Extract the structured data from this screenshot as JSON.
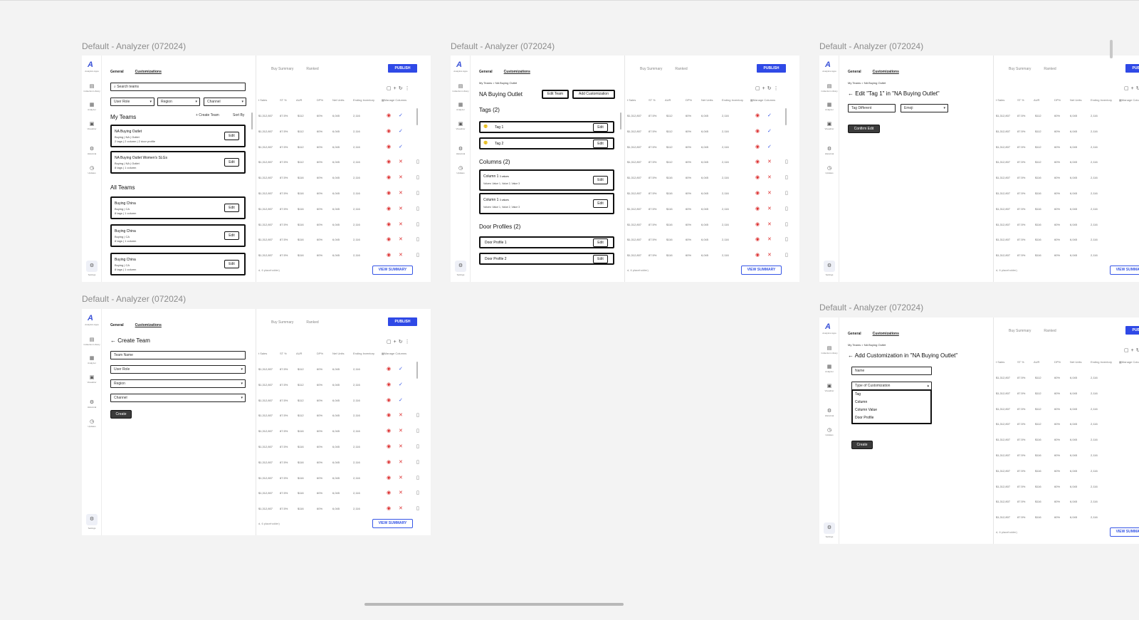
{
  "canvas": {
    "frame_label": "Default - Analyzer (072024)"
  },
  "app": {
    "sidebar": [
      {
        "glyph": "▤",
        "label": "Collection Library"
      },
      {
        "glyph": "▦",
        "label": "Analyzer"
      },
      {
        "glyph": "▣",
        "label": "Visualizer"
      },
      {
        "glyph": "⚙",
        "label": "Historical"
      },
      {
        "glyph": "◷",
        "label": "Updates"
      }
    ],
    "logo_label": "Analytics Apps",
    "settings_label": "Settings",
    "panel_tabs": {
      "general": "General",
      "customizations": "Customizations"
    },
    "bg_tabs": [
      "Buy Summary",
      "Ranked"
    ],
    "publish": "PUBLISH",
    "manage_columns": "Manage Columns",
    "table_headers": [
      "t Sales",
      "ST %",
      "AUR",
      "DP%",
      "Net Units",
      "Ending Inventory"
    ],
    "row_values_a": [
      "$1,312,807",
      "87.5%",
      "$112",
      "60%",
      "6,045",
      "2,116"
    ],
    "row_values_b": [
      "$1,312,807",
      "87.5%",
      "$116",
      "60%",
      "6,045",
      "2,116"
    ],
    "footer_text": "d, 6 placeholder)",
    "view_summary": "VIEW SUMMARY"
  },
  "screen1": {
    "search_placeholder": "Search teams",
    "filters": [
      "User Role",
      "Region",
      "Channel"
    ],
    "my_teams": "My Teams",
    "create_team_link": "+ Create Team",
    "sort_by": "Sort By",
    "all_teams": "All Teams",
    "edit": "Edit",
    "my_team_cards": [
      {
        "title": "NA Buying Outlet",
        "line1": "Buying | NA | Outlet",
        "line2": "2 tags | 2 column | 2 door profile"
      },
      {
        "title": "NA Buying Outlet Women's SLGs",
        "line1": "Buying | NA | Outlet",
        "line2": "8 tags | 1 column"
      }
    ],
    "all_team_cards": [
      {
        "title": "Buying China",
        "line1": "Buying | CA",
        "line2": "8 tags | 1 column"
      },
      {
        "title": "Buying China",
        "line1": "Buying | CA",
        "line2": "8 tags | 1 column"
      },
      {
        "title": "Buying China",
        "line1": "Buying | CA",
        "line2": "8 tags | 1 column"
      }
    ]
  },
  "screen2": {
    "breadcrumb": "My Teams > NA Buying Outlet",
    "title": "NA Buying Outlet",
    "edit_team": "Edit Team",
    "add_customization": "Add Customization",
    "tags_header": "Tags (2)",
    "tags": [
      {
        "emoji": "🙂",
        "name": "Tag 1"
      },
      {
        "emoji": "🙂",
        "name": "Tag 2"
      }
    ],
    "columns_header": "Columns (2)",
    "columns": [
      {
        "name": "Column 1",
        "count": "3 values",
        "values": "Values: Value 1, Value 2, Value 3"
      },
      {
        "name": "Column 1",
        "count": "3 values",
        "values": "Values: Value 1, Value 2, Value 3"
      }
    ],
    "door_profiles_header": "Door Profiles (2)",
    "door_profiles": [
      "Door Profile 1",
      "Door Profile 2"
    ],
    "edit": "Edit"
  },
  "screen3": {
    "breadcrumb": "My Teams > NA Buying Outlet",
    "title": "Edit \"Tag 1\" in \"NA Buying Outlet\"",
    "tag_value": "Tag Different",
    "emoji_select": "Emoji",
    "confirm": "Confirm Edit"
  },
  "screen4": {
    "title": "Create Team",
    "name_placeholder": "Team Name",
    "selects": [
      "User Role",
      "Region",
      "Channel"
    ],
    "create": "Create"
  },
  "screen5": {
    "breadcrumb": "My Teams > NA Buying Outlet",
    "title": "Add Customization in \"NA Buying Outlet\"",
    "name_placeholder": "Name",
    "type_select": "Type of Customization",
    "options": [
      "Tag",
      "Column",
      "Column Value",
      "Door Profile"
    ],
    "create": "Create"
  }
}
